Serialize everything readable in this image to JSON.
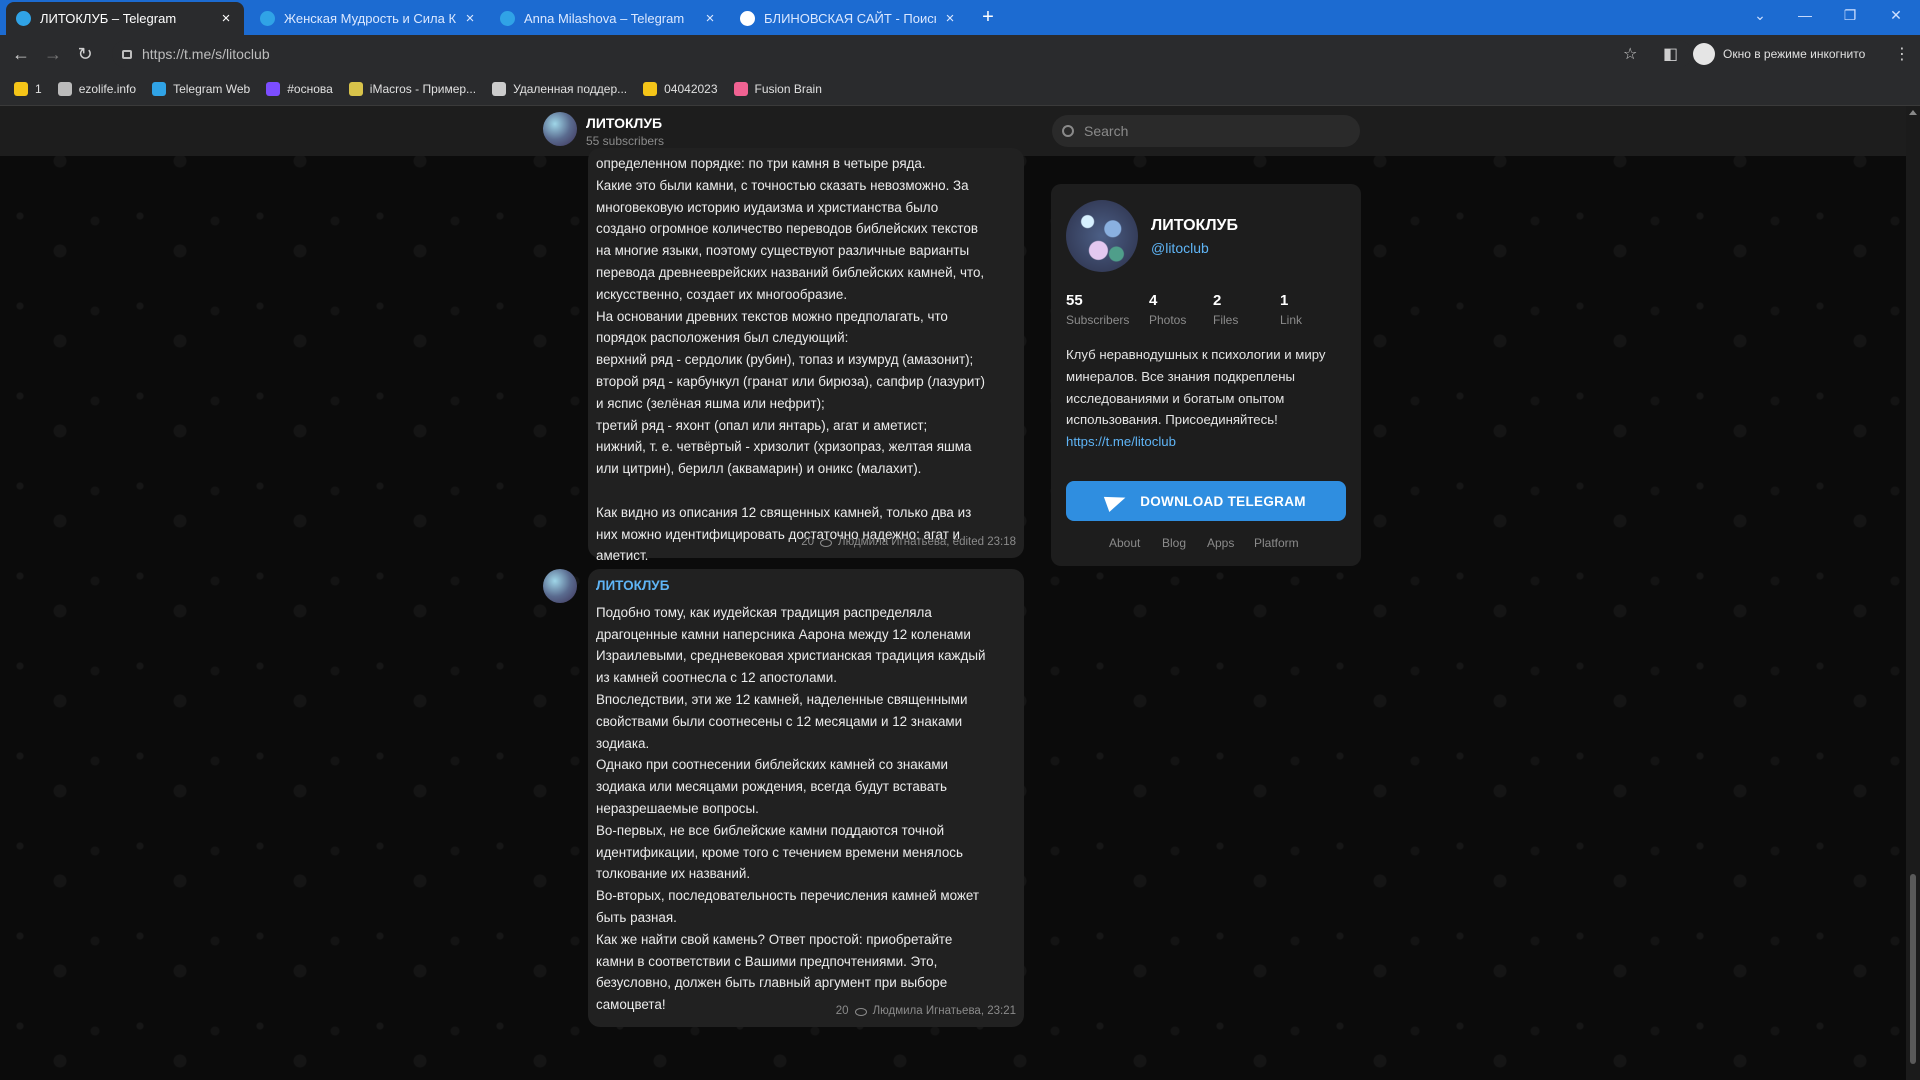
{
  "browser": {
    "tabs": [
      {
        "label": "ЛИТОКЛУБ – Telegram",
        "active": true
      },
      {
        "label": "Женская Мудрость и Сила Кри",
        "active": false
      },
      {
        "label": "Anna Milashova – Telegram",
        "active": false
      },
      {
        "label": "БЛИНОВСКАЯ САЙТ - Поиск в",
        "active": false
      }
    ],
    "tab_close": "×",
    "new_tab": "+",
    "url": "https://t.me/s/litoclub",
    "incognito_label": "Окно в режиме инкогнито",
    "bookmarks": [
      {
        "label": "1",
        "icon": "folder-icon",
        "color": "#f5c518"
      },
      {
        "label": "ezolife.info",
        "icon": "globe-icon",
        "color": "#bbbbbb"
      },
      {
        "label": "Telegram Web",
        "icon": "telegram-icon",
        "color": "#30a3e6"
      },
      {
        "label": "#основа",
        "icon": "site-icon",
        "color": "#7c4dff"
      },
      {
        "label": "iMacros - Пример...",
        "icon": "imacros-icon",
        "color": "#d8c34a"
      },
      {
        "label": "Удаленная поддер...",
        "icon": "remote-icon",
        "color": "#cccccc"
      },
      {
        "label": "04042023",
        "icon": "folder-icon",
        "color": "#f5c518"
      },
      {
        "label": "Fusion Brain",
        "icon": "brain-icon",
        "color": "#f06292"
      }
    ]
  },
  "channel": {
    "name": "ЛИТОКЛУБ",
    "subscribers_line": "55 subscribers",
    "search_placeholder": "Search"
  },
  "messages": [
    {
      "lines": [
        "определенном порядке: по три камня в четыре ряда.",
        "Какие это были камни, с точностью сказать невозможно. За",
        "многовековую историю иудаизма и христианства было",
        "создано огромное количество переводов библейских текстов",
        "на многие языки, поэтому существуют различные варианты",
        "перевода древнееврейских названий библейских камней, что,",
        "искусственно, создает их многообразие.",
        "На основании древних текстов можно предполагать, что",
        "порядок расположения был следующий:",
        "верхний ряд - сердолик (рубин), топаз и изумруд (амазонит);",
        "второй ряд - карбункул (гранат или бирюза), сапфир (лазурит)",
        "и яспис (зелёная яшма или нефрит);",
        "третий ряд - яхонт (опал или янтарь), агат и аметист;",
        "нижний, т. е. четвёртый - хризолит (хризопраз, желтая яшма",
        "или цитрин), берилл (аквамарин) и оникс (малахит).",
        "",
        "Как видно из описания 12 священных камней, только два из",
        "них можно идентифицировать достаточно надежно: агат и",
        "аметист."
      ],
      "views": "20",
      "signature": "Людмила Игнатьева, edited  23:18"
    },
    {
      "author": "ЛИТОКЛУБ",
      "lines": [
        "Подобно тому, как иудейская традиция распределяла",
        "драгоценные камни наперсника Аарона между 12 коленами",
        "Израилевыми, средневековая христианская традиция каждый",
        "из камней соотнесла с 12 апостолами.",
        "Впоследствии, эти же 12 камней, наделенные священными",
        "свойствами были соотнесены с 12 месяцами и 12 знаками",
        "зодиака.",
        "Однако при соотнесении библейских камней со знаками",
        "зодиака или месяцами рождения, всегда будут вставать",
        "неразрешаемые вопросы.",
        "Во-первых, не все библейские камни поддаются точной",
        "идентификации, кроме того с течением времени менялось",
        "толкование их названий.",
        "Во-вторых, последовательность перечисления камней может",
        "быть разная.",
        "Как же найти свой камень? Ответ простой: приобретайте",
        "камни в соответствии с Вашими предпочтениями. Это,",
        "безусловно, должен быть главный аргумент при выборе",
        "самоцвета!"
      ],
      "views": "20",
      "signature": "Людмила Игнатьева, 23:21"
    }
  ],
  "info_card": {
    "title": "ЛИТОКЛУБ",
    "handle": "@litoclub",
    "stats": [
      {
        "value": "55",
        "label": "Subscribers"
      },
      {
        "value": "4",
        "label": "Photos"
      },
      {
        "value": "2",
        "label": "Files"
      },
      {
        "value": "1",
        "label": "Link"
      }
    ],
    "description_lines": [
      "Клуб неравнодушных к психологии и миру",
      "минералов. Все знания подкреплены",
      "исследованиями и богатым опытом",
      "использования. Присоединяйтесь!"
    ],
    "link": "https://t.me/litoclub",
    "download_label": "DOWNLOAD TELEGRAM",
    "footer": [
      "About",
      "Blog",
      "Apps",
      "Platform"
    ]
  },
  "colors": {
    "accent": "#2f8ee0",
    "link": "#5fb4f5",
    "tabstrip": "#1c6bd1"
  }
}
